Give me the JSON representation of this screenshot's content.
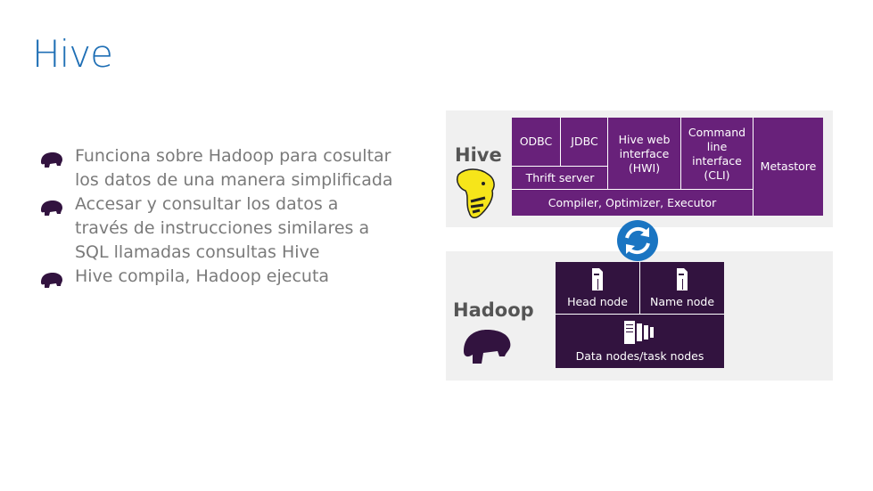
{
  "title": "Hive",
  "bullets": [
    "Funciona sobre Hadoop para cosultar los datos de una manera simplificada",
    "Accesar y consultar los datos a través de instrucciones similares a SQL llamadas consultas Hive",
    "Hive compila, Hadoop ejecuta"
  ],
  "diagram": {
    "hive_panel": {
      "label": "Hive",
      "odbc": "ODBC",
      "jdbc": "JDBC",
      "thrift": "Thrift server",
      "hwi": "Hive web interface (HWI)",
      "cli": "Command line interface (CLI)",
      "metastore": "Metastore",
      "compiler": "Compiler, Optimizer, Executor"
    },
    "hadoop_panel": {
      "label": "Hadoop",
      "head_node": "Head node",
      "name_node": "Name node",
      "data_nodes": "Data nodes/task nodes"
    },
    "colors": {
      "title_blue": "#1f6fb5",
      "hive_purple": "#68217a",
      "hadoop_dark_purple": "#32133f",
      "sync_blue": "#1a75c2",
      "hive_logo_yellow": "#f6e51a"
    }
  }
}
